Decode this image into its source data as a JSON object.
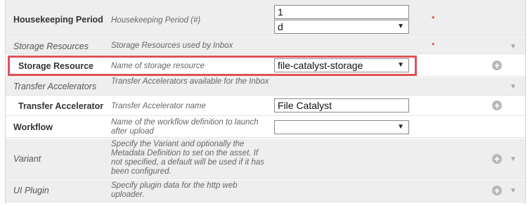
{
  "rows": [
    {
      "name": "Housekeeping Period",
      "description": "Housekeeping Period (#)",
      "value_number": "1",
      "value_unit": "d",
      "required": "*"
    },
    {
      "name": "Storage Resources",
      "description": "Storage Resources used by Inbox",
      "required": "*"
    },
    {
      "name": "Storage Resource",
      "description": "Name of storage resource",
      "value": "file-catalyst-storage"
    },
    {
      "name": "Transfer Accelerators",
      "description": "Transfer Accelerators available for the Inbox"
    },
    {
      "name": "Transfer Accelerator",
      "description": "Transfer Accelerator name",
      "value": "File Catalyst"
    },
    {
      "name": "Workflow",
      "description": "Name of the workflow definition to launch after upload",
      "value": ""
    },
    {
      "name": "Variant",
      "description": "Specify the Variant and optionally the Metadata Definition to set on the asset. If not specified, a default will be used if it has been configured."
    },
    {
      "name": "UI Plugin",
      "description": "Specify plugin data for the http web uploader."
    }
  ],
  "icons": {
    "dropdown": "▼",
    "add": "+",
    "collapse": "▼"
  },
  "colors": {
    "highlight": "#e0525a",
    "required": "#d00000"
  }
}
